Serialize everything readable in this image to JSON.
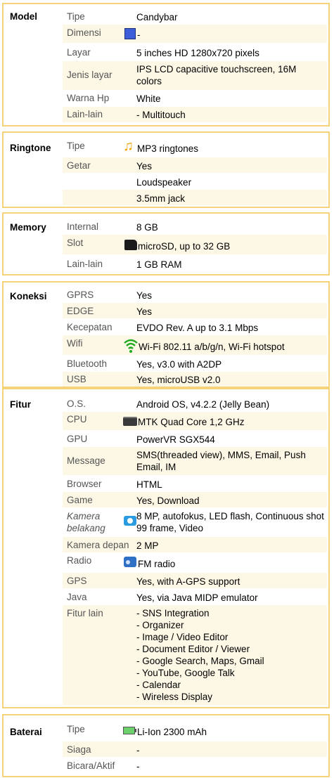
{
  "sections": {
    "model": {
      "title": "Model",
      "rows": [
        {
          "label": "Tipe",
          "value": "Candybar"
        },
        {
          "label": "Dimensi",
          "value": "-",
          "icon": "dimension-icon"
        },
        {
          "label": "Layar",
          "value": "5 inches HD 1280x720 pixels"
        },
        {
          "label": "Jenis layar",
          "value": "IPS LCD capacitive touchscreen, 16M colors"
        },
        {
          "label": "Warna Hp",
          "value": "White"
        },
        {
          "label": "Lain-lain",
          "value": "- Multitouch"
        }
      ]
    },
    "ringtone": {
      "title": "Ringtone",
      "rows": [
        {
          "label": "Tipe",
          "value": "MP3 ringtones",
          "icon": "music-note-icon"
        },
        {
          "label": "Getar",
          "value": "Yes"
        },
        {
          "label": "",
          "value": "Loudspeaker"
        },
        {
          "label": "",
          "value": "3.5mm jack"
        }
      ]
    },
    "memory": {
      "title": "Memory",
      "rows": [
        {
          "label": "Internal",
          "value": "8 GB"
        },
        {
          "label": "Slot",
          "value": "microSD, up to 32 GB",
          "icon": "sd-card-icon"
        },
        {
          "label": "Lain-lain",
          "value": "1 GB RAM"
        }
      ]
    },
    "koneksi": {
      "title": "Koneksi",
      "rows": [
        {
          "label": "GPRS",
          "value": "Yes"
        },
        {
          "label": "EDGE",
          "value": "Yes"
        },
        {
          "label": "Kecepatan",
          "value": "EVDO Rev. A up to 3.1 Mbps"
        },
        {
          "label": "Wifi",
          "value": "Wi-Fi 802.11 a/b/g/n, Wi-Fi hotspot",
          "icon": "wifi-icon"
        },
        {
          "label": "Bluetooth",
          "value": "Yes, v3.0 with A2DP"
        },
        {
          "label": "USB",
          "value": "Yes, microUSB v2.0"
        }
      ]
    },
    "fitur": {
      "title": "Fitur",
      "rows": [
        {
          "label": "O.S.",
          "value": "Android OS, v4.2.2 (Jelly Bean)"
        },
        {
          "label": "CPU",
          "value": "MTK Quad Core 1,2 GHz",
          "icon": "cpu-icon"
        },
        {
          "label": "GPU",
          "value": "PowerVR SGX544"
        },
        {
          "label": "Message",
          "value": "SMS(threaded view), MMS, Email, Push Email, IM"
        },
        {
          "label": "Browser",
          "value": "HTML"
        },
        {
          "label": "Game",
          "value": "Yes, Download"
        },
        {
          "label": "Kamera belakang",
          "value": "8 MP, autofokus, LED flash, Continuous shot 99 frame, Video",
          "icon": "camera-icon"
        },
        {
          "label": "Kamera depan",
          "value": "2 MP"
        },
        {
          "label": "Radio",
          "value": "FM radio",
          "icon": "radio-icon"
        },
        {
          "label": "GPS",
          "value": "Yes, with A-GPS support"
        },
        {
          "label": "Java",
          "value": "Yes, via Java MIDP emulator"
        },
        {
          "label": "Fitur lain",
          "value_lines": [
            "- SNS Integration",
            "- Organizer",
            "- Image / Video Editor",
            "- Document Editor / Viewer",
            "- Google Search, Maps, Gmail",
            "- YouTube, Google Talk",
            "- Calendar",
            "- Wireless Display"
          ]
        }
      ]
    },
    "baterai": {
      "title": "Baterai",
      "rows": [
        {
          "label": "Tipe",
          "value": "Li-Ion 2300 mAh",
          "icon": "battery-icon"
        },
        {
          "label": "Siaga",
          "value": "-"
        },
        {
          "label": "Bicara/Aktif",
          "value": "-"
        }
      ]
    }
  },
  "colors": {
    "border": "#f6d27a",
    "alt_row": "#fdf8e6",
    "label": "#555555"
  }
}
